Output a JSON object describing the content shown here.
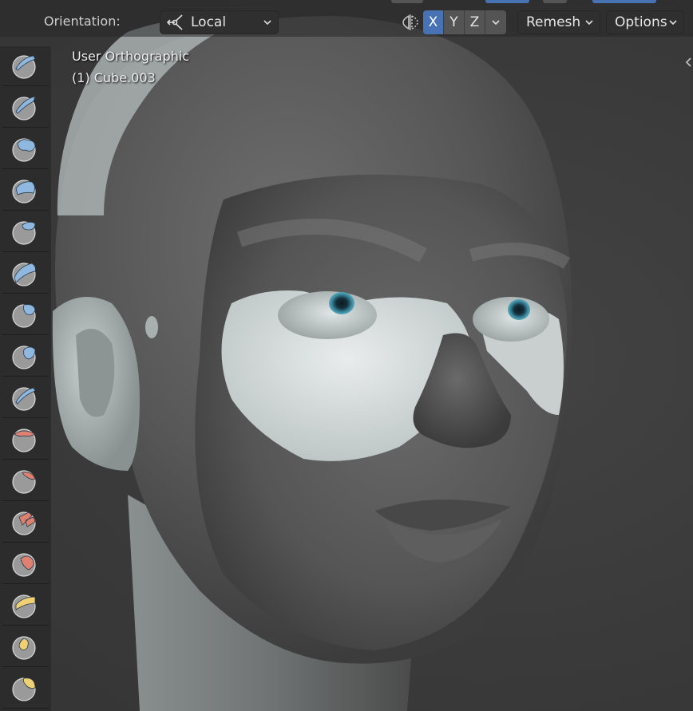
{
  "header": {
    "orientation_label": "Orientation:",
    "orientation_value": "Local",
    "axes": [
      {
        "label": "X",
        "active": true
      },
      {
        "label": "Y",
        "active": false
      },
      {
        "label": "Z",
        "active": false
      }
    ],
    "remesh_label": "Remesh",
    "options_label": "Options"
  },
  "viewport": {
    "view_name": "User Orthographic",
    "object_name": "(1) Cube.003"
  },
  "toolbar": {
    "tools": [
      {
        "name": "draw-tool",
        "color": "#8fb8e0"
      },
      {
        "name": "draw-sharp-tool",
        "color": "#8fb8e0"
      },
      {
        "name": "clay-tool",
        "color": "#8fb8e0"
      },
      {
        "name": "clay-strips-tool",
        "color": "#8fb8e0"
      },
      {
        "name": "layer-tool",
        "color": "#8fb8e0"
      },
      {
        "name": "inflate-tool",
        "color": "#8fb8e0"
      },
      {
        "name": "blob-tool",
        "color": "#8fb8e0"
      },
      {
        "name": "crease-tool",
        "color": "#8fb8e0"
      },
      {
        "name": "smooth-tool",
        "color": "#8fb8e0"
      },
      {
        "name": "flatten-tool",
        "color": "#e08070"
      },
      {
        "name": "fill-tool",
        "color": "#e08070"
      },
      {
        "name": "scrape-tool",
        "color": "#e08070"
      },
      {
        "name": "multiplane-scrape-tool",
        "color": "#e08070"
      },
      {
        "name": "pinch-tool",
        "color": "#f0d070"
      },
      {
        "name": "grab-tool",
        "color": "#f0d070"
      },
      {
        "name": "elastic-deform-tool",
        "color": "#f0d070"
      }
    ]
  },
  "colors": {
    "accent": "#4772b3",
    "toolbar_bg": "#2c2c2c",
    "viewport_bg": "#3d3d3d"
  }
}
